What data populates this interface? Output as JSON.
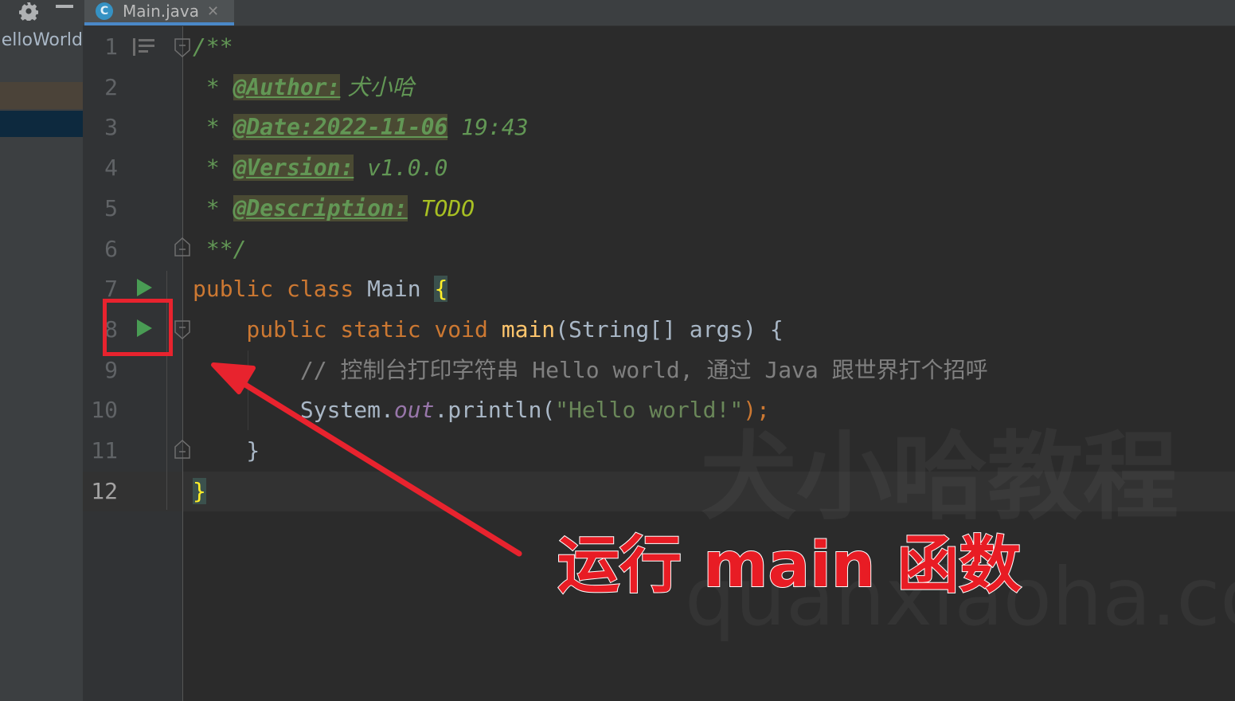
{
  "project_panel": {
    "tree_root": "HelloWorld"
  },
  "tabs": [
    {
      "icon": "java-class-icon",
      "icon_letter": "C",
      "label": "Main.java",
      "active": true
    }
  ],
  "editor": {
    "current_line": 12,
    "line_numbers": [
      "1",
      "2",
      "3",
      "4",
      "5",
      "6",
      "7",
      "8",
      "9",
      "10",
      "11",
      "12"
    ],
    "lines": [
      {
        "no": 1,
        "parts": [
          {
            "t": "/**",
            "c": "cmt"
          }
        ]
      },
      {
        "no": 2,
        "parts": [
          {
            "t": " * ",
            "c": "cmt"
          },
          {
            "t": "@Author:",
            "c": "tag"
          },
          {
            "t": " 犬小哈",
            "c": "cmt cjk"
          }
        ]
      },
      {
        "no": 3,
        "parts": [
          {
            "t": " * ",
            "c": "cmt"
          },
          {
            "t": "@Date:2022-11-06",
            "c": "tag"
          },
          {
            "t": " 19:43",
            "c": "cmt"
          }
        ]
      },
      {
        "no": 4,
        "parts": [
          {
            "t": " * ",
            "c": "cmt"
          },
          {
            "t": "@Version:",
            "c": "tag"
          },
          {
            "t": " v1.0.0",
            "c": "cmt"
          }
        ]
      },
      {
        "no": 5,
        "parts": [
          {
            "t": " * ",
            "c": "cmt"
          },
          {
            "t": "@Description:",
            "c": "tag"
          },
          {
            "t": " TODO",
            "c": "todo"
          }
        ]
      },
      {
        "no": 6,
        "parts": [
          {
            "t": " **/",
            "c": "cmt"
          }
        ]
      },
      {
        "no": 7,
        "parts": [
          {
            "t": "public class ",
            "c": "kw"
          },
          {
            "t": "Main ",
            "c": ""
          },
          {
            "t": "{",
            "c": "brace-hl"
          }
        ]
      },
      {
        "no": 8,
        "parts": [
          {
            "t": "    public static void ",
            "c": "kw"
          },
          {
            "t": "main",
            "c": "fn"
          },
          {
            "t": "(String[] args) {",
            "c": ""
          }
        ]
      },
      {
        "no": 9,
        "parts": [
          {
            "t": "        // ",
            "c": "line-cmt"
          },
          {
            "t": "控制台打印字符串",
            "c": "line-cmt cjk"
          },
          {
            "t": " Hello world, ",
            "c": "line-cmt"
          },
          {
            "t": "通过",
            "c": "line-cmt cjk"
          },
          {
            "t": " Java ",
            "c": "line-cmt"
          },
          {
            "t": "跟世界打个招呼",
            "c": "line-cmt cjk"
          }
        ]
      },
      {
        "no": 10,
        "parts": [
          {
            "t": "        System.",
            "c": ""
          },
          {
            "t": "out",
            "c": "fld"
          },
          {
            "t": ".println(",
            "c": ""
          },
          {
            "t": "\"Hello world!\"",
            "c": "str"
          },
          {
            "t": ");",
            "c": "kw"
          }
        ]
      },
      {
        "no": 11,
        "parts": [
          {
            "t": "    }",
            "c": ""
          }
        ]
      },
      {
        "no": 12,
        "parts": [
          {
            "t": "}",
            "c": "brace-hl"
          }
        ]
      }
    ],
    "run_gutter_lines": [
      7,
      8
    ],
    "fold_marker_lines": [
      1,
      6,
      8,
      11
    ]
  },
  "annotation": {
    "label": "运行 main 函数",
    "color": "#e81c24"
  },
  "watermark": {
    "title": "犬小哈教程",
    "url": "quanxiaoha.com"
  },
  "colors": {
    "background": "#2b2b2b",
    "gutter": "#313335",
    "keyword": "#cc7832",
    "function": "#ffc66d",
    "string": "#6a8759",
    "doc_comment": "#629755",
    "line_comment": "#808080",
    "run_icon": "#499c54",
    "tab_accent": "#4a88c7"
  }
}
